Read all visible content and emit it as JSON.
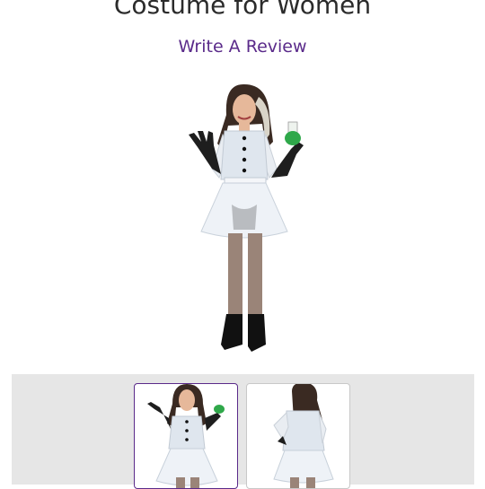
{
  "product": {
    "title": "Costume for Women",
    "review_link": "Write A Review"
  },
  "gallery": {
    "main_image": "costume-front-photo",
    "thumbnails": [
      {
        "image": "costume-front-photo",
        "selected": true
      },
      {
        "image": "costume-back-photo",
        "selected": false
      }
    ]
  },
  "colors": {
    "accent": "#5a2a8a",
    "title": "#2b2b2b",
    "strip_bg": "#e6e6e6"
  }
}
